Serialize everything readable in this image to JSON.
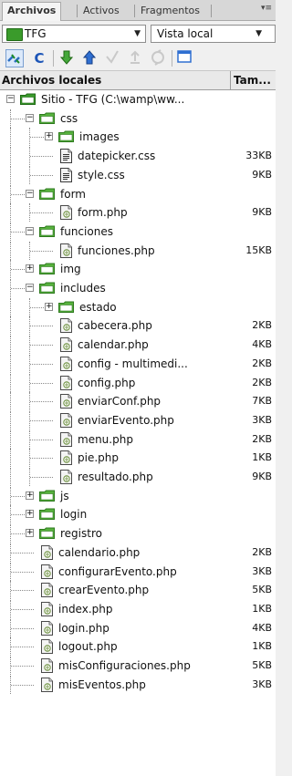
{
  "tabs": [
    "Archivos",
    "Activos",
    "Fragmentos"
  ],
  "site_select": "TFG",
  "view_select": "Vista local",
  "columns": {
    "name": "Archivos locales",
    "size": "Tam..."
  },
  "tree": [
    {
      "depth": 0,
      "type": "site",
      "expander": "minus",
      "label": "Sitio - TFG (C:\\wamp\\ww...",
      "size": ""
    },
    {
      "depth": 1,
      "type": "folder",
      "expander": "minus",
      "label": "css",
      "size": ""
    },
    {
      "depth": 2,
      "type": "folder",
      "expander": "plus",
      "label": "images",
      "size": ""
    },
    {
      "depth": 2,
      "type": "css",
      "expander": "",
      "label": "datepicker.css",
      "size": "33KB"
    },
    {
      "depth": 2,
      "type": "css",
      "expander": "",
      "label": "style.css",
      "size": "9KB"
    },
    {
      "depth": 1,
      "type": "folder",
      "expander": "minus",
      "label": "form",
      "size": ""
    },
    {
      "depth": 2,
      "type": "php",
      "expander": "",
      "label": "form.php",
      "size": "9KB"
    },
    {
      "depth": 1,
      "type": "folder",
      "expander": "minus",
      "label": "funciones",
      "size": ""
    },
    {
      "depth": 2,
      "type": "php",
      "expander": "",
      "label": "funciones.php",
      "size": "15KB"
    },
    {
      "depth": 1,
      "type": "folder",
      "expander": "plus",
      "label": "img",
      "size": ""
    },
    {
      "depth": 1,
      "type": "folder",
      "expander": "minus",
      "label": "includes",
      "size": ""
    },
    {
      "depth": 2,
      "type": "folder",
      "expander": "plus",
      "label": "estado",
      "size": ""
    },
    {
      "depth": 2,
      "type": "php",
      "expander": "",
      "label": "cabecera.php",
      "size": "2KB"
    },
    {
      "depth": 2,
      "type": "php",
      "expander": "",
      "label": "calendar.php",
      "size": "4KB"
    },
    {
      "depth": 2,
      "type": "php",
      "expander": "",
      "label": "config - multimedi...",
      "size": "2KB"
    },
    {
      "depth": 2,
      "type": "php",
      "expander": "",
      "label": "config.php",
      "size": "2KB"
    },
    {
      "depth": 2,
      "type": "php",
      "expander": "",
      "label": "enviarConf.php",
      "size": "7KB"
    },
    {
      "depth": 2,
      "type": "php",
      "expander": "",
      "label": "enviarEvento.php",
      "size": "3KB"
    },
    {
      "depth": 2,
      "type": "php",
      "expander": "",
      "label": "menu.php",
      "size": "2KB"
    },
    {
      "depth": 2,
      "type": "php",
      "expander": "",
      "label": "pie.php",
      "size": "1KB"
    },
    {
      "depth": 2,
      "type": "php",
      "expander": "",
      "label": "resultado.php",
      "size": "9KB"
    },
    {
      "depth": 1,
      "type": "folder",
      "expander": "plus",
      "label": "js",
      "size": ""
    },
    {
      "depth": 1,
      "type": "folder",
      "expander": "plus",
      "label": "login",
      "size": ""
    },
    {
      "depth": 1,
      "type": "folder",
      "expander": "plus",
      "label": "registro",
      "size": ""
    },
    {
      "depth": 1,
      "type": "php",
      "expander": "",
      "label": "calendario.php",
      "size": "2KB"
    },
    {
      "depth": 1,
      "type": "php",
      "expander": "",
      "label": "configurarEvento.php",
      "size": "3KB"
    },
    {
      "depth": 1,
      "type": "php",
      "expander": "",
      "label": "crearEvento.php",
      "size": "5KB"
    },
    {
      "depth": 1,
      "type": "php",
      "expander": "",
      "label": "index.php",
      "size": "1KB"
    },
    {
      "depth": 1,
      "type": "php",
      "expander": "",
      "label": "login.php",
      "size": "4KB"
    },
    {
      "depth": 1,
      "type": "php",
      "expander": "",
      "label": "logout.php",
      "size": "1KB"
    },
    {
      "depth": 1,
      "type": "php",
      "expander": "",
      "label": "misConfiguraciones.php",
      "size": "5KB"
    },
    {
      "depth": 1,
      "type": "php",
      "expander": "",
      "label": "misEventos.php",
      "size": "3KB"
    }
  ]
}
